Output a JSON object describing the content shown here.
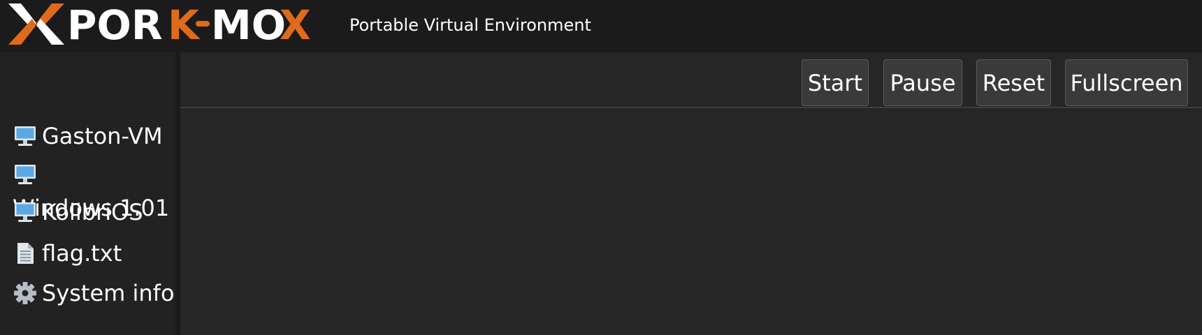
{
  "header": {
    "logo_text": "PORK-MOX",
    "subtitle": "Portable Virtual Environment"
  },
  "sidebar": {
    "items": [
      {
        "label": "Gaston-VM",
        "icon": "monitor-icon"
      },
      {
        "label": "Windows 1.01",
        "icon": "monitor-icon"
      },
      {
        "label": "KolibriOS",
        "icon": "monitor-icon"
      },
      {
        "label": "flag.txt",
        "icon": "text-file-icon"
      },
      {
        "label": "System info",
        "icon": "gear-icon"
      }
    ]
  },
  "toolbar": {
    "start_label": "Start",
    "pause_label": "Pause",
    "reset_label": "Reset",
    "fullscreen_label": "Fullscreen"
  },
  "colors": {
    "accent_orange": "#e06a1c",
    "header_bg": "#1b1b1b",
    "sidebar_bg": "#222222",
    "main_bg": "#262626",
    "button_bg": "#3a3a3a"
  }
}
